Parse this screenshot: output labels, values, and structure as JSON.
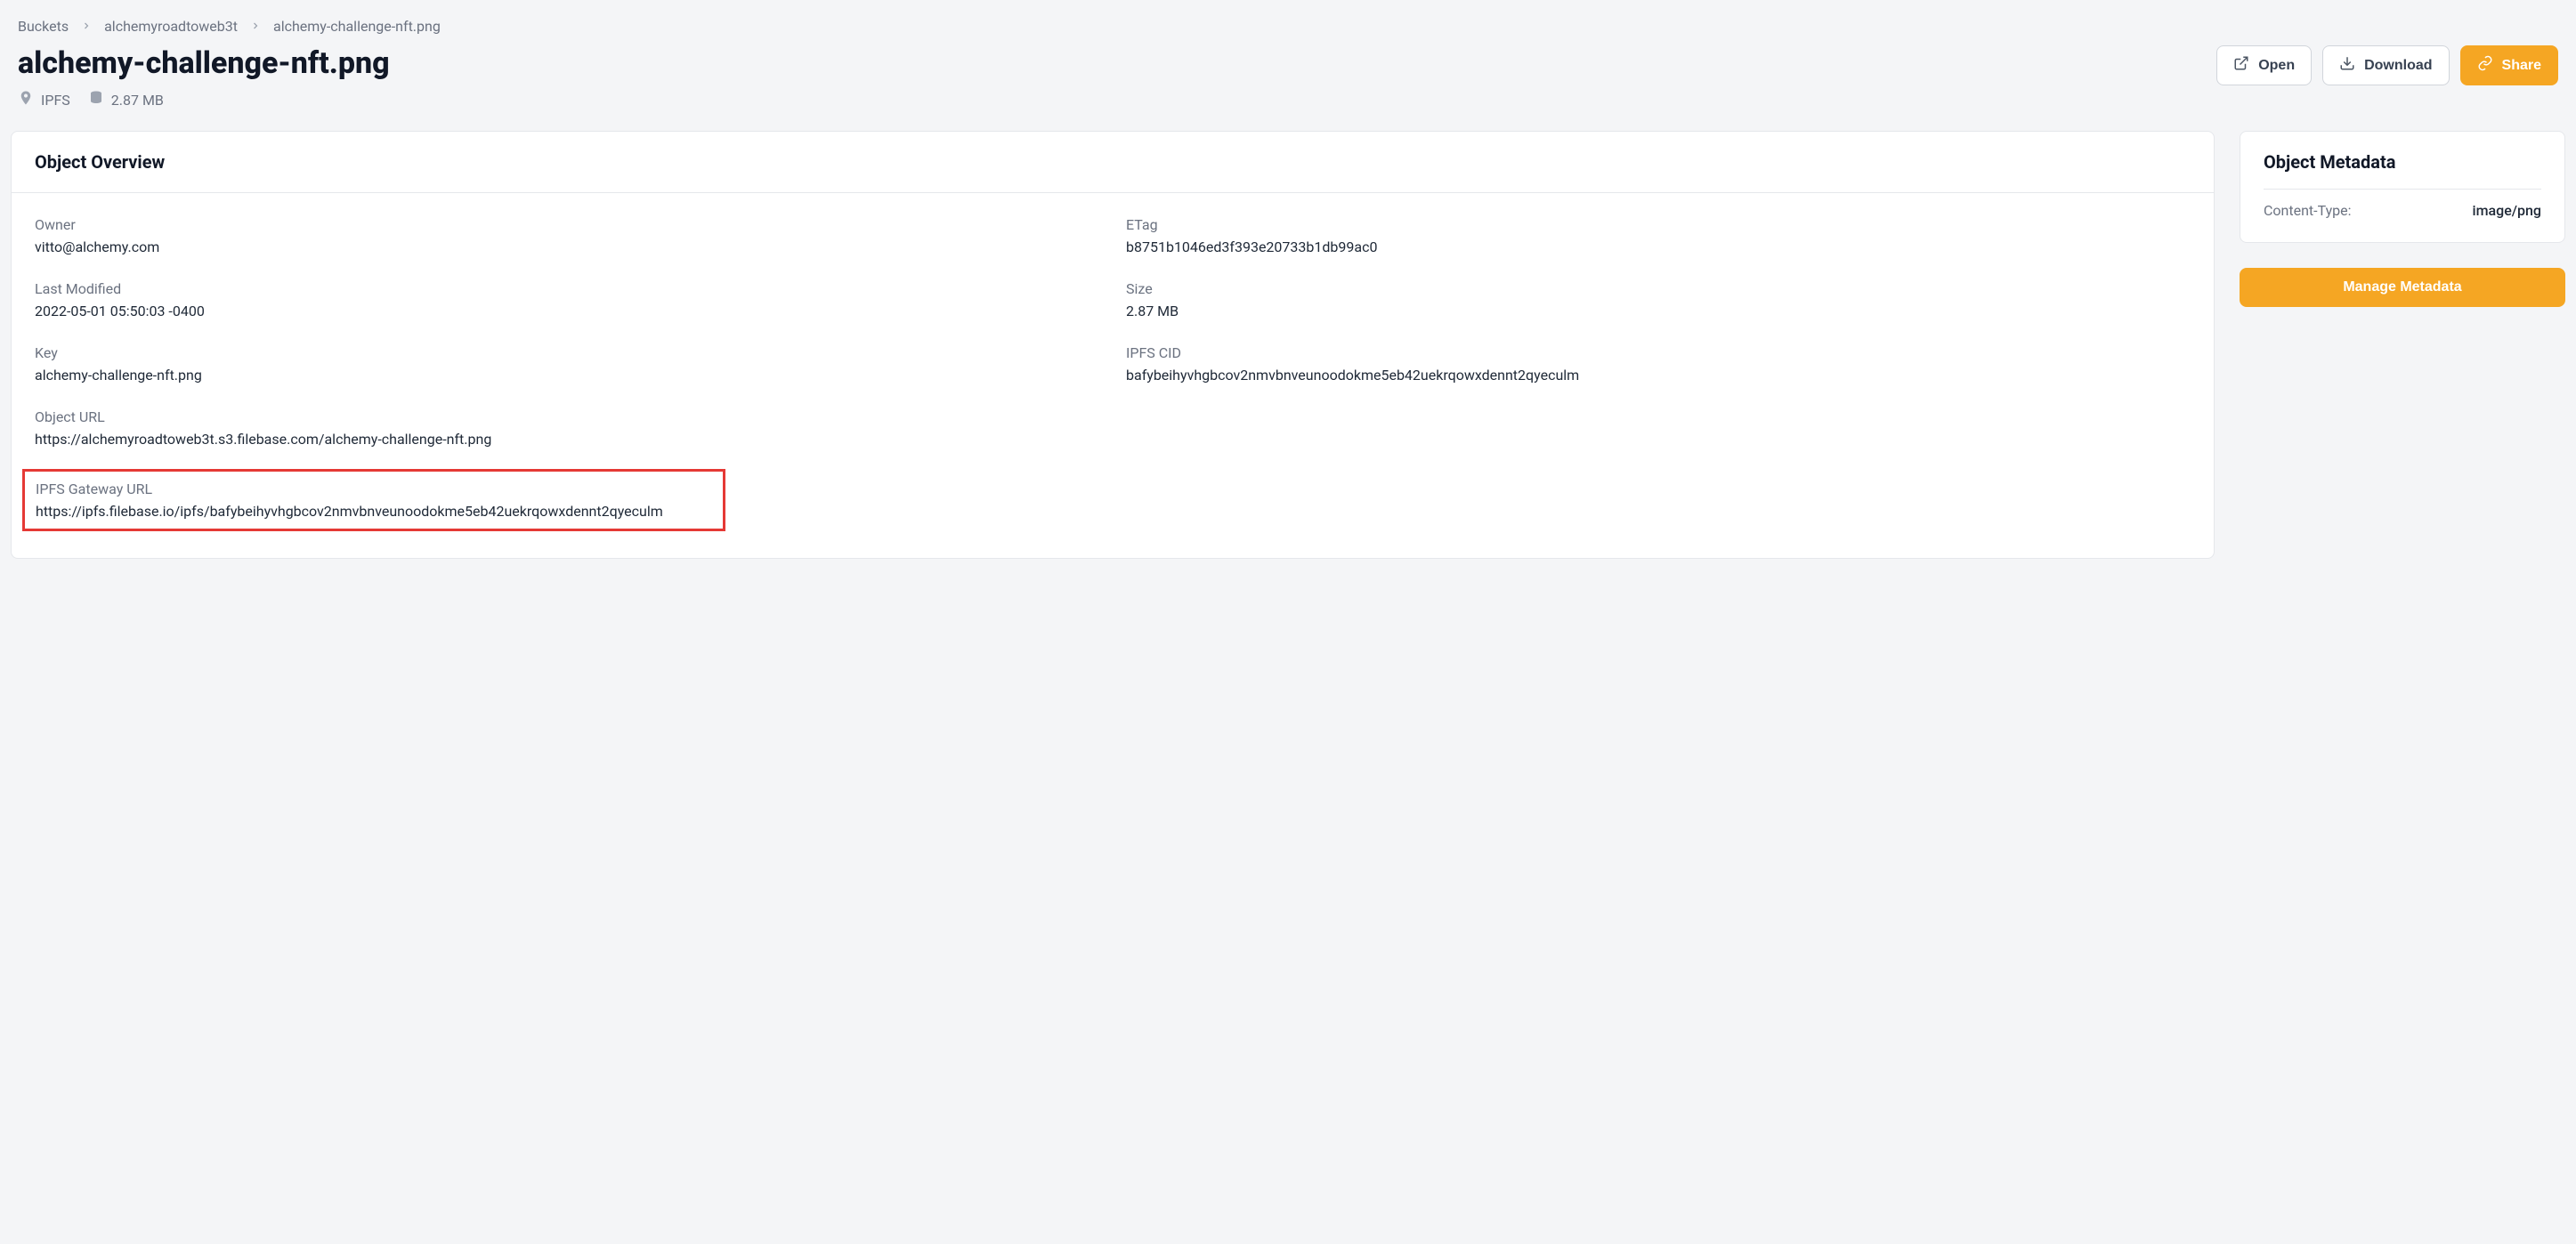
{
  "breadcrumb": {
    "root": "Buckets",
    "bucket": "alchemyroadtoweb3t",
    "file": "alchemy-challenge-nft.png"
  },
  "title": "alchemy-challenge-nft.png",
  "meta": {
    "network": "IPFS",
    "size": "2.87 MB"
  },
  "actions": {
    "open": "Open",
    "download": "Download",
    "share": "Share"
  },
  "overview": {
    "heading": "Object Overview",
    "owner_label": "Owner",
    "owner_value": "vitto@alchemy.com",
    "etag_label": "ETag",
    "etag_value": "b8751b1046ed3f393e20733b1db99ac0",
    "last_modified_label": "Last Modified",
    "last_modified_value": "2022-05-01 05:50:03 -0400",
    "size_label": "Size",
    "size_value": "2.87 MB",
    "key_label": "Key",
    "key_value": "alchemy-challenge-nft.png",
    "cid_label": "IPFS CID",
    "cid_value": "bafybeihyvhgbcov2nmvbnveunoodokme5eb42uekrqowxdennt2qyeculm",
    "object_url_label": "Object URL",
    "object_url_value": "https://alchemyroadtoweb3t.s3.filebase.com/alchemy-challenge-nft.png",
    "gateway_url_label": "IPFS Gateway URL",
    "gateway_url_value": "https://ipfs.filebase.io/ipfs/bafybeihyvhgbcov2nmvbnveunoodokme5eb42uekrqowxdennt2qyeculm"
  },
  "metadata": {
    "heading": "Object Metadata",
    "content_type_label": "Content-Type:",
    "content_type_value": "image/png",
    "manage_button": "Manage Metadata"
  }
}
